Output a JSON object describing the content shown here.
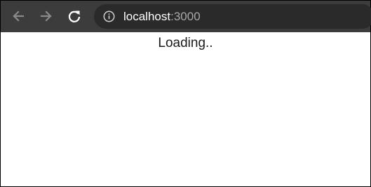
{
  "browser": {
    "url_host": "localhost",
    "url_port": ":3000",
    "icons": [
      "back-arrow-icon",
      "forward-arrow-icon",
      "reload-icon",
      "info-icon"
    ]
  },
  "page": {
    "status_text": "Loading.."
  },
  "colors": {
    "toolbar": "#3c3c3c",
    "omnibox": "#2a2a2a",
    "url_text": "#ffffff",
    "url_port": "#a9a9a9",
    "nav_icon_disabled": "#8a8a8a",
    "nav_icon_enabled": "#ffffff",
    "page_background": "#ffffff"
  }
}
